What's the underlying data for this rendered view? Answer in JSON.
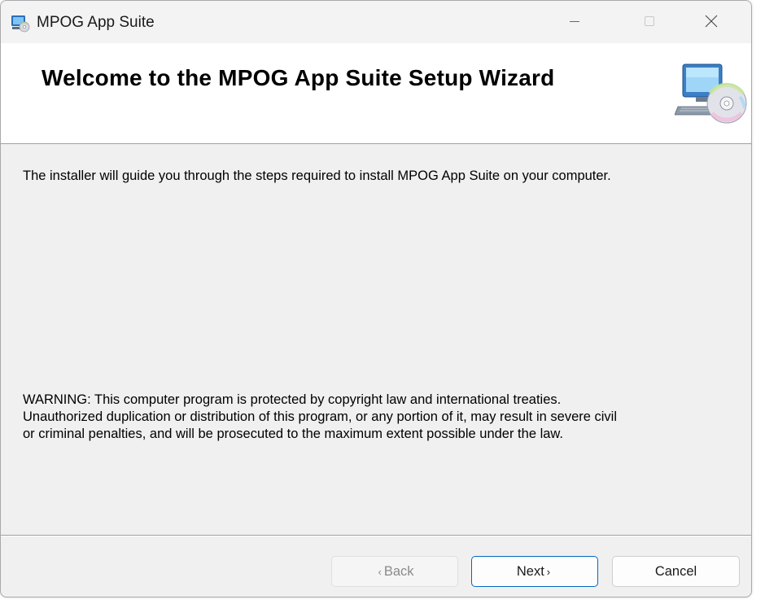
{
  "window": {
    "title": "MPOG App Suite"
  },
  "banner": {
    "title": "Welcome to the MPOG App Suite Setup Wizard"
  },
  "body": {
    "intro": "The installer will guide you through the steps required to install MPOG App Suite on your computer.",
    "warning_lines": [
      "WARNING: This computer program is protected by copyright law and international treaties.",
      "Unauthorized duplication or distribution of this program, or any portion of it, may result in severe civil",
      "or criminal penalties, and will be prosecuted to the maximum extent possible under the law."
    ]
  },
  "buttons": {
    "back_label": "Back",
    "back_prefix": "‹",
    "next_label": "Next",
    "next_suffix": "›",
    "cancel_label": "Cancel"
  },
  "colors": {
    "accent": "#0067c0",
    "dialog_bg": "#f0f0f0",
    "banner_bg": "#ffffff"
  },
  "icons": {
    "app": "installer-computer-icon",
    "banner": "computer-cd-icon",
    "minimize": "minimize-icon",
    "maximize": "maximize-icon",
    "close": "close-icon"
  }
}
